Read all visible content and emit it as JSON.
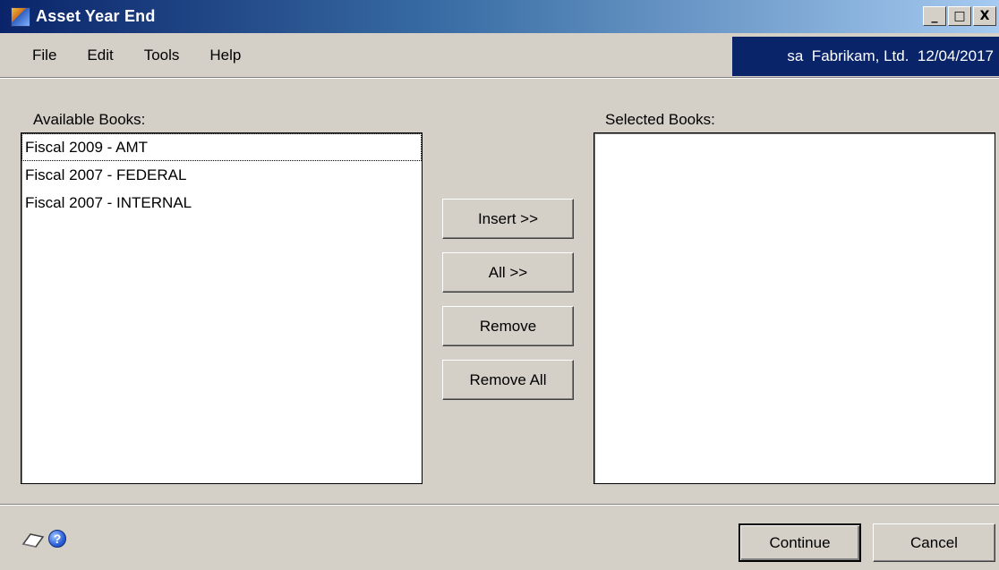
{
  "window": {
    "title": "Asset Year End",
    "minimize_glyph": "_",
    "maximize_glyph": "□",
    "close_glyph": "X"
  },
  "menu": {
    "items": [
      "File",
      "Edit",
      "Tools",
      "Help"
    ]
  },
  "header": {
    "user_company_date": "sa  Fabrikam, Ltd.  12/04/2017"
  },
  "available": {
    "label": "Available Books:",
    "items": [
      "Fiscal 2009 - AMT",
      "Fiscal 2007 - FEDERAL",
      "Fiscal 2007 - INTERNAL"
    ],
    "focused_index": 0
  },
  "selected": {
    "label": "Selected Books:",
    "items": []
  },
  "actions": {
    "insert": "Insert >>",
    "all": "All >>",
    "remove": "Remove",
    "remove_all": "Remove All"
  },
  "footer": {
    "note_icon": "note-icon",
    "help_icon": "help-icon",
    "help_glyph": "?",
    "continue": "Continue",
    "cancel": "Cancel"
  },
  "colors": {
    "titlebar_start": "#0a246a",
    "titlebar_end": "#a6caf0",
    "window_bg": "#d4d0c8",
    "company_box_bg": "#0a246a"
  }
}
